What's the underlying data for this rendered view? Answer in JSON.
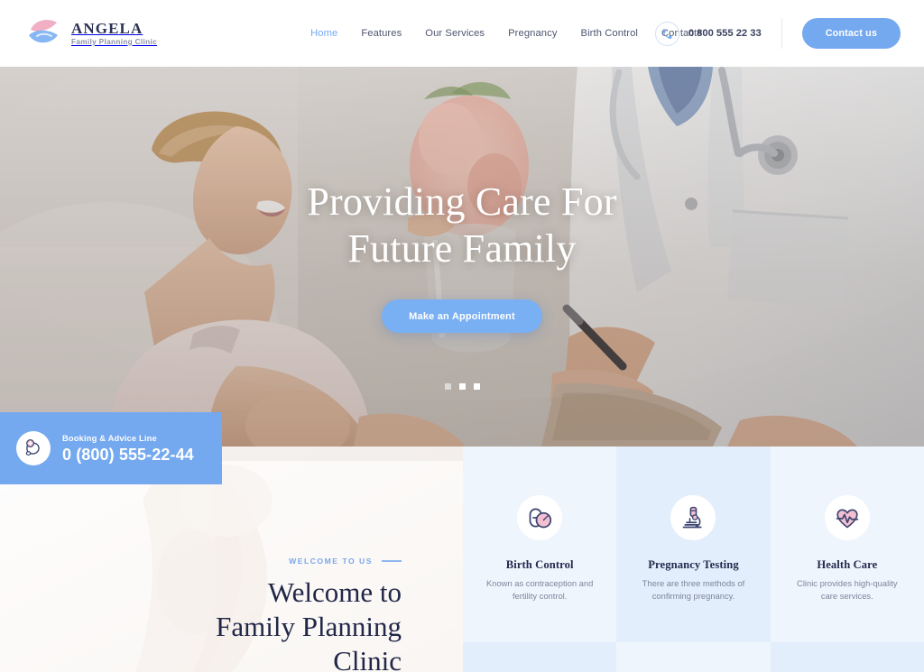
{
  "brand": {
    "name": "ANGELA",
    "tagline": "Family Planning Clinic",
    "logo_icon": "hands-heart-logo-icon",
    "accent_blue": "#74a9f0",
    "accent_pink": "#f3b9cc",
    "dark_navy": "#232a4d"
  },
  "header": {
    "nav": [
      {
        "label": "Home",
        "active": true
      },
      {
        "label": "Features",
        "active": false
      },
      {
        "label": "Our Services",
        "active": false
      },
      {
        "label": "Pregnancy",
        "active": false
      },
      {
        "label": "Birth Control",
        "active": false
      },
      {
        "label": "Contacts",
        "active": false
      }
    ],
    "phone_icon": "phone-icon",
    "phone": "0 800 555 22 33",
    "contact_button": "Contact us"
  },
  "hero": {
    "title_line1": "Providing Care For",
    "title_line2": "Future Family",
    "cta_label": "Make an Appointment",
    "slides": [
      {
        "active": false
      },
      {
        "active": true
      },
      {
        "active": true
      }
    ]
  },
  "booking": {
    "icon": "medical-phone-icon",
    "label": "Booking & Advice Line",
    "number": "0 (800) 555-22-44"
  },
  "welcome": {
    "eyebrow": "WELCOME TO US",
    "title_line1": "Welcome to",
    "title_line2": "Family Planning",
    "title_line3": "Clinic"
  },
  "services": [
    {
      "icon": "pills-icon",
      "title": "Birth Control",
      "desc": "Known as contraception and fertility control.",
      "shade": "a"
    },
    {
      "icon": "microscope-icon",
      "title": "Pregnancy Testing",
      "desc": "There are three methods of confirming pregnancy.",
      "shade": "b"
    },
    {
      "icon": "heart-pulse-icon",
      "title": "Health Care",
      "desc": "Clinic provides high-quality care services.",
      "shade": "a"
    }
  ],
  "services_row2_shades": [
    "b",
    "a",
    "b"
  ]
}
